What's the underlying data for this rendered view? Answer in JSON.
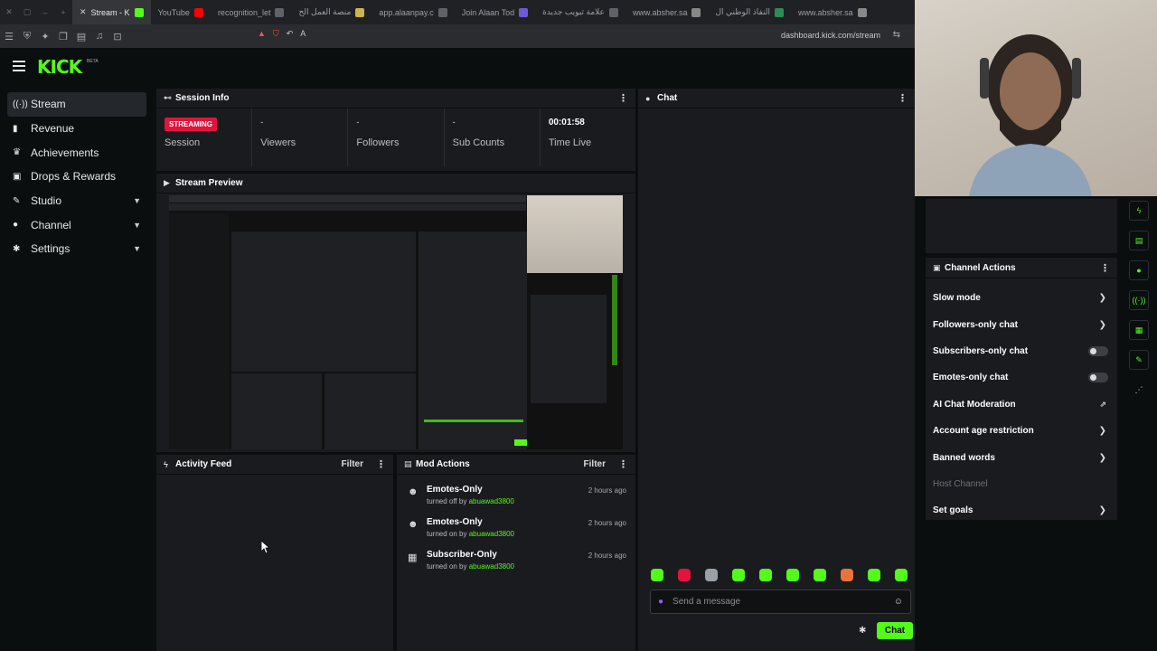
{
  "browser": {
    "tabs": [
      {
        "label": "Stream - K",
        "color": "#53fc18",
        "active": true
      },
      {
        "label": "YouTube",
        "color": "#ff0000",
        "active": false
      },
      {
        "label": "recognition_let",
        "color": "#5f6368",
        "active": false
      },
      {
        "label": "منصة العمل الح",
        "color": "#ccb34a",
        "active": false
      },
      {
        "label": "app.alaanpay.c",
        "color": "#5f6368",
        "active": false
      },
      {
        "label": "Join Alaan Tod",
        "color": "#6b5bd6",
        "active": false
      },
      {
        "label": "علامة تبويب جديدة",
        "color": "#5f6368",
        "active": false
      },
      {
        "label": "www.absher.sa",
        "color": "#888888",
        "active": false
      },
      {
        "label": "النفاذ الوطني ال",
        "color": "#2e8b57",
        "active": false
      },
      {
        "label": "www.absher.sa",
        "color": "#888888",
        "active": false
      }
    ],
    "url": "dashboard.kick.com/stream"
  },
  "brand": {
    "logo": "KICK",
    "beta": "BETA",
    "accent": "#53fc18"
  },
  "sidebar": {
    "items": [
      {
        "label": "Stream",
        "icon": "stream-icon",
        "glyph": "((·))",
        "active": true,
        "chevron": false
      },
      {
        "label": "Revenue",
        "icon": "money-icon",
        "glyph": "▮",
        "active": false,
        "chevron": false
      },
      {
        "label": "Achievements",
        "icon": "trophy-icon",
        "glyph": "♛",
        "active": false,
        "chevron": false
      },
      {
        "label": "Drops & Rewards",
        "icon": "gift-icon",
        "glyph": "▣",
        "active": false,
        "chevron": false
      },
      {
        "label": "Studio",
        "icon": "studio-icon",
        "glyph": "✎",
        "active": false,
        "chevron": true
      },
      {
        "label": "Channel",
        "icon": "user-icon",
        "glyph": "●",
        "active": false,
        "chevron": true
      },
      {
        "label": "Settings",
        "icon": "gear-icon",
        "glyph": "✱",
        "active": false,
        "chevron": true
      }
    ]
  },
  "session": {
    "title": "Session Info",
    "badge": "STREAMING",
    "stats": [
      {
        "value": "STREAMING",
        "label": "Session"
      },
      {
        "value": "-",
        "label": "Viewers"
      },
      {
        "value": "-",
        "label": "Followers"
      },
      {
        "value": "-",
        "label": "Sub Counts"
      },
      {
        "value": "00:01:58",
        "label": "Time Live"
      }
    ]
  },
  "preview": {
    "title": "Stream Preview"
  },
  "activity": {
    "title": "Activity Feed",
    "filter": "Filter"
  },
  "mod": {
    "title": "Mod Actions",
    "filter": "Filter",
    "items": [
      {
        "title": "Emotes-Only",
        "action": "turned off by",
        "user": "abuawad3800",
        "time": "2 hours ago",
        "icon": "smiley-icon"
      },
      {
        "title": "Emotes-Only",
        "action": "turned on by",
        "user": "abuawad3800",
        "time": "2 hours ago",
        "icon": "smiley-icon"
      },
      {
        "title": "Subscriber-Only",
        "action": "turned on by",
        "user": "abuawad3800",
        "time": "2 hours ago",
        "icon": "gift-icon"
      }
    ]
  },
  "chat": {
    "title": "Chat",
    "placeholder": "Send a message",
    "send": "Chat"
  },
  "channel_actions": {
    "title": "Channel Actions",
    "items": [
      {
        "label": "Slow mode",
        "control": "chevron"
      },
      {
        "label": "Followers-only chat",
        "control": "chevron"
      },
      {
        "label": "Subscribers-only chat",
        "control": "toggle"
      },
      {
        "label": "Emotes-only chat",
        "control": "toggle"
      },
      {
        "label": "AI Chat Moderation",
        "control": "external"
      },
      {
        "label": "Account age restriction",
        "control": "chevron"
      },
      {
        "label": "Banned words",
        "control": "chevron"
      },
      {
        "label": "Host Channel",
        "control": "disabled"
      },
      {
        "label": "Set goals",
        "control": "chevron"
      }
    ]
  }
}
